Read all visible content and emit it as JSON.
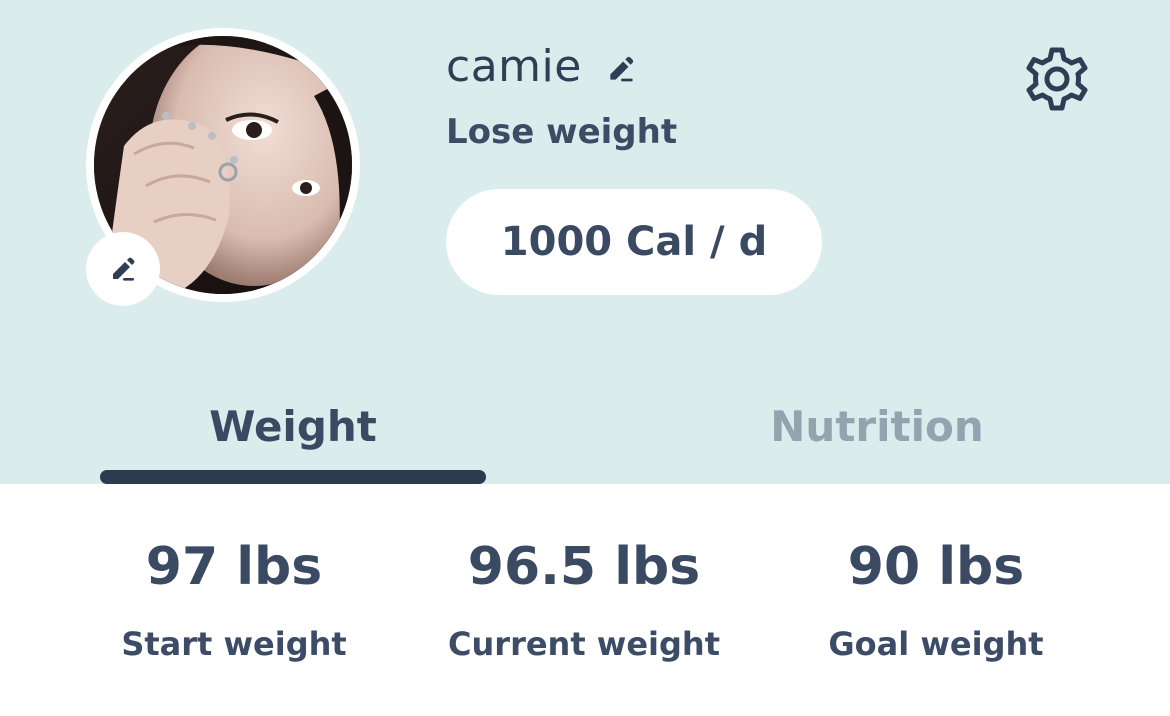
{
  "profile": {
    "username": "camie",
    "goal": "Lose weight",
    "calorie_target": "1000 Cal / d"
  },
  "icons": {
    "avatar_edit": "pencil-icon",
    "username_edit": "pencil-icon",
    "settings": "gear-icon"
  },
  "tabs": [
    {
      "label": "Weight",
      "active": true
    },
    {
      "label": "Nutrition",
      "active": false
    }
  ],
  "stats": [
    {
      "value": "97 lbs",
      "label": "Start weight"
    },
    {
      "value": "96.5 lbs",
      "label": "Current weight"
    },
    {
      "value": "90 lbs",
      "label": "Goal weight"
    }
  ],
  "colors": {
    "header_bg": "#daeceb",
    "text_primary": "#3b4a63",
    "tab_inactive": "#95a2b0",
    "tab_indicator": "#2c3a50"
  }
}
